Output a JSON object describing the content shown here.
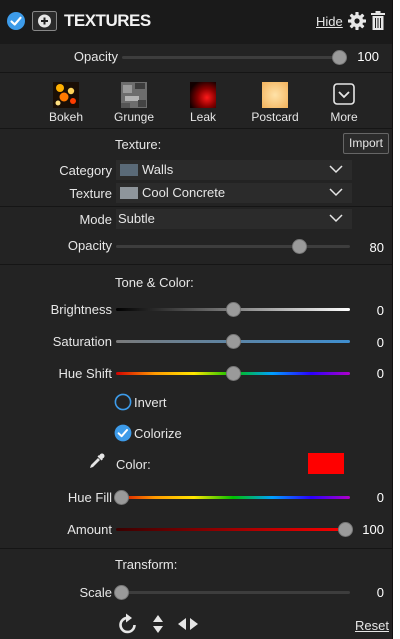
{
  "header": {
    "title": "TEXTURES",
    "hide_label": "Hide"
  },
  "opacity_top": {
    "label": "Opacity",
    "value": "100",
    "level": 1.0
  },
  "presets": [
    {
      "label": "Bokeh"
    },
    {
      "label": "Grunge"
    },
    {
      "label": "Leak"
    },
    {
      "label": "Postcard"
    },
    {
      "label": "More"
    }
  ],
  "texture_section": {
    "heading": "Texture:",
    "import_label": "Import",
    "category_label": "Category",
    "category_value": "Walls",
    "texture_label": "Texture",
    "texture_value": "Cool Concrete",
    "mode_label": "Mode",
    "mode_value": "Subtle",
    "opacity_label": "Opacity",
    "opacity_value": "80",
    "opacity_level": 0.8
  },
  "tone_section": {
    "heading": "Tone & Color:",
    "brightness_label": "Brightness",
    "brightness_value": "0",
    "saturation_label": "Saturation",
    "saturation_value": "0",
    "hue_shift_label": "Hue Shift",
    "hue_shift_value": "0",
    "invert_label": "Invert",
    "invert_checked": false,
    "colorize_label": "Colorize",
    "colorize_checked": true,
    "color_label": "Color:",
    "color_swatch": "#ff0000",
    "hue_fill_label": "Hue Fill",
    "hue_fill_value": "0",
    "amount_label": "Amount",
    "amount_value": "100"
  },
  "transform_section": {
    "heading": "Transform:",
    "scale_label": "Scale",
    "scale_value": "0",
    "reset_label": "Reset"
  },
  "colors": {
    "accent": "#3d9be9",
    "panel_bg": "#232323"
  }
}
